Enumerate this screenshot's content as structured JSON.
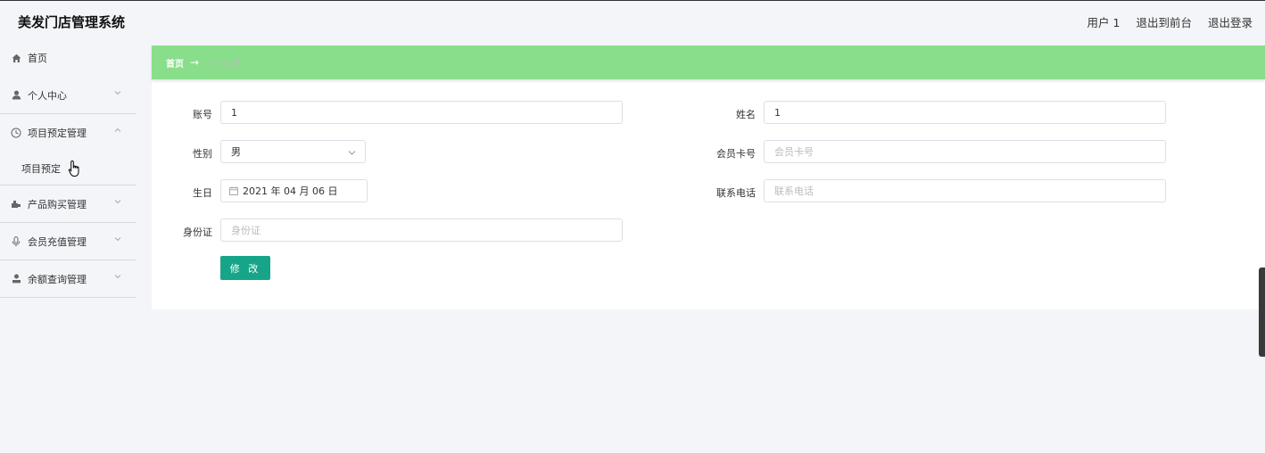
{
  "header": {
    "title": "美发门店管理系统",
    "user": "用户 1",
    "front_link": "退出到前台",
    "logout_link": "退出登录"
  },
  "sidebar": {
    "items": [
      {
        "label": "首页",
        "icon": "home-icon"
      },
      {
        "label": "个人中心",
        "icon": "user-icon",
        "expanded": false
      },
      {
        "label": "项目预定管理",
        "icon": "clock-icon",
        "expanded": true,
        "children": [
          "项目预定"
        ]
      },
      {
        "label": "产品购买管理",
        "icon": "cart-icon",
        "expanded": false
      },
      {
        "label": "会员充值管理",
        "icon": "mic-icon",
        "expanded": false
      },
      {
        "label": "余额查询管理",
        "icon": "user-stamp-icon",
        "expanded": false
      }
    ]
  },
  "breadcrumb": {
    "home": "首页",
    "arrow": "→",
    "current": "个人信息"
  },
  "form": {
    "account": {
      "label": "账号",
      "value": "1"
    },
    "name": {
      "label": "姓名",
      "value": "1"
    },
    "gender": {
      "label": "性别",
      "value": "男"
    },
    "member_card": {
      "label": "会员卡号",
      "placeholder": "会员卡号"
    },
    "birthday": {
      "label": "生日",
      "value": "2021 年 04 月 06 日"
    },
    "phone": {
      "label": "联系电话",
      "placeholder": "联系电话"
    },
    "id_card": {
      "label": "身份证",
      "placeholder": "身份证"
    },
    "submit": "修 改"
  },
  "colors": {
    "accent": "#17a589",
    "breadcrumb_bg": "#89de8b"
  }
}
